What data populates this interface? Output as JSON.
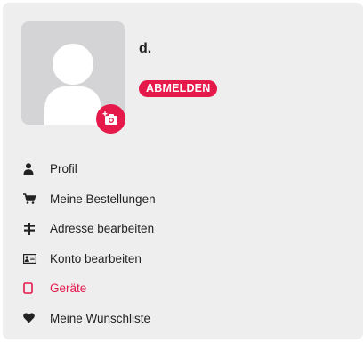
{
  "profile": {
    "username": "d.",
    "logout_label": "ABMELDEN"
  },
  "menu": {
    "items": [
      {
        "label": "Profil",
        "icon": "user-icon"
      },
      {
        "label": "Meine Bestellungen",
        "icon": "cart-icon"
      },
      {
        "label": "Adresse bearbeiten",
        "icon": "signpost-icon"
      },
      {
        "label": "Konto bearbeiten",
        "icon": "id-card-icon"
      },
      {
        "label": "Geräte",
        "icon": "device-icon",
        "active": true
      },
      {
        "label": "Meine Wunschliste",
        "icon": "heart-icon"
      }
    ]
  },
  "colors": {
    "accent": "#e5194a",
    "panel": "#eeeeef",
    "avatar_bg": "#d4d4d6"
  }
}
